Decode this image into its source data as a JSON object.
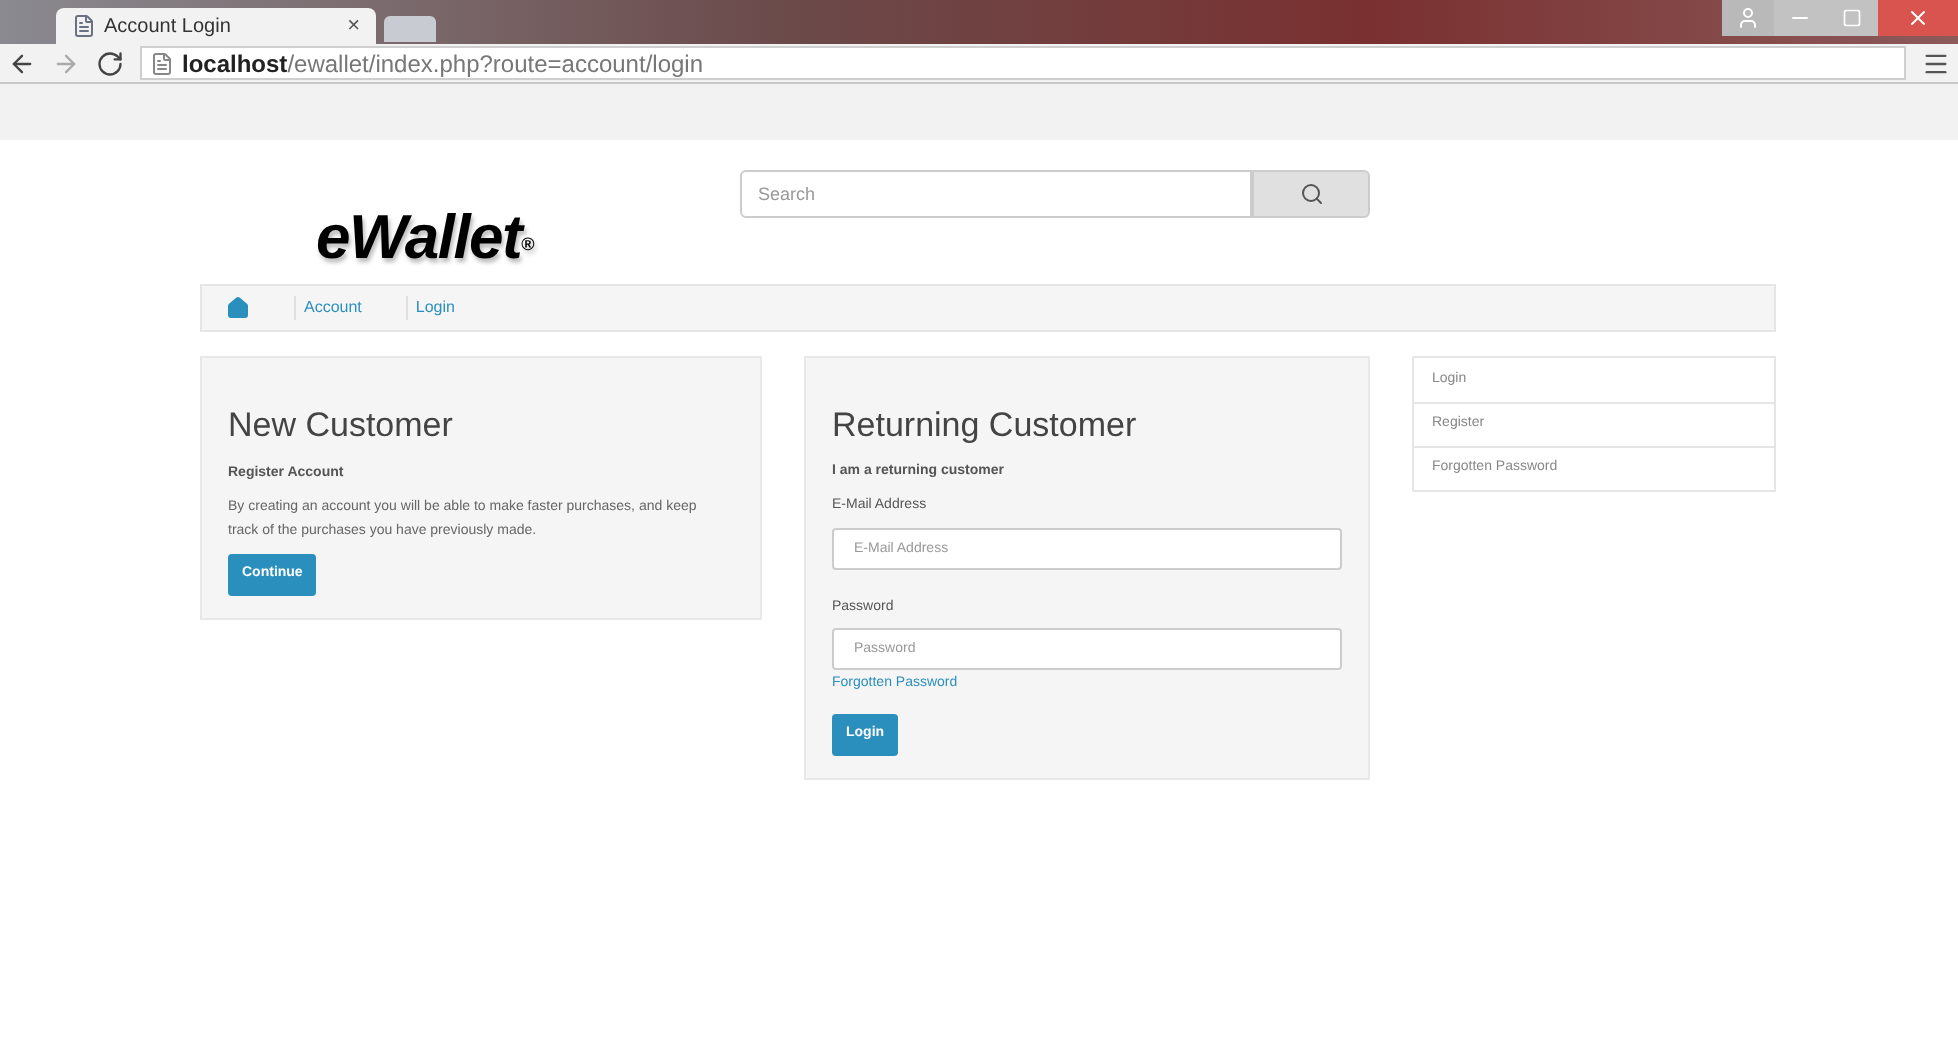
{
  "browser": {
    "tab": {
      "title": "Account Login",
      "close": "×"
    },
    "url": "**localhost**/ewallet/index.php?route=account/login"
  },
  "header": {
    "logo": "eWallet",
    "logo_mark": "®",
    "search": {
      "placeholder": "Search"
    }
  },
  "breadcrumb": [
    {
      "label": "Account"
    },
    {
      "label": "Login"
    }
  ],
  "new_customer": {
    "title": "New Customer",
    "subtitle": "Register Account",
    "text": "By creating an account you will be able to make faster purchases, and keep track of the purchases you have previously made.",
    "button": "Continue"
  },
  "returning_customer": {
    "title": "Returning Customer",
    "subtitle": "I am a returning customer",
    "fields": [
      {
        "label": "E-Mail Address",
        "placeholder": "E-Mail Address"
      },
      {
        "label": "Password",
        "placeholder": "Password"
      }
    ],
    "link": "Forgotten Password",
    "button": "Login"
  },
  "sidebar": {
    "items": [
      {
        "label": "Login"
      },
      {
        "label": "Register"
      },
      {
        "label": "Forgotten Password"
      }
    ]
  }
}
